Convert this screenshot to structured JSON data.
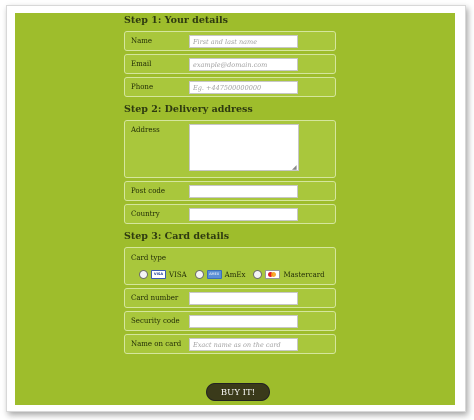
{
  "step1": {
    "title": "Step 1: Your details",
    "name": {
      "label": "Name",
      "placeholder": "First and last name"
    },
    "email": {
      "label": "Email",
      "placeholder": "example@domain.com"
    },
    "phone": {
      "label": "Phone",
      "placeholder": "Eg. +447500000000"
    }
  },
  "step2": {
    "title": "Step 2: Delivery address",
    "address": {
      "label": "Address"
    },
    "postcode": {
      "label": "Post code"
    },
    "country": {
      "label": "Country"
    }
  },
  "step3": {
    "title": "Step 3: Card details",
    "card_type": {
      "label": "Card type",
      "options": [
        {
          "label": "VISA",
          "logo": "VISA"
        },
        {
          "label": "AmEx",
          "logo": "AMEX"
        },
        {
          "label": "Mastercard"
        }
      ]
    },
    "card_number": {
      "label": "Card number"
    },
    "security_code": {
      "label": "Security code"
    },
    "name_on_card": {
      "label": "Name on card",
      "placeholder": "Exact name as on the card"
    }
  },
  "buy_button": {
    "label": "BUY IT!"
  },
  "colors": {
    "background": "#9ebd2c",
    "row": "#a9c73c",
    "button": "#3a3a1a"
  }
}
